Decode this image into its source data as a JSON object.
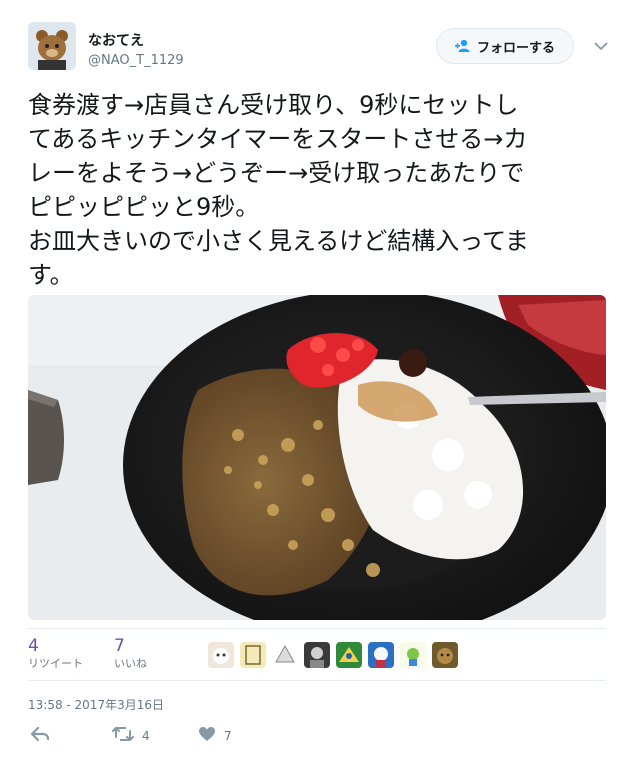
{
  "user": {
    "display_name": "なおてえ",
    "handle": "@NAO_T_1129"
  },
  "follow_button": {
    "label": "フォローする"
  },
  "tweet": {
    "text": "食券渡す→店員さん受け取り、9秒にセットし\nてあるキッチンタイマーをスタートさせる→カ\nレーをよそう→どうぞー→受け取ったあたりで\nピピッピピッと9秒。\nお皿大きいので小さく見えるけど結構入ってま\nす。"
  },
  "media": {
    "icon": "curry-photo"
  },
  "stats": {
    "retweets": {
      "count": "4",
      "label": "リツイート"
    },
    "likes": {
      "count": "7",
      "label": "いいね"
    }
  },
  "likers_count": 8,
  "timestamp": "13:58 - 2017年3月16日",
  "actions": {
    "reply": {
      "icon": "reply-icon"
    },
    "retweet": {
      "icon": "retweet-icon",
      "count": "4"
    },
    "like": {
      "icon": "heart-icon",
      "count": "7"
    }
  },
  "colors": {
    "count_purple": "#6e4fa8",
    "secondary_text": "#657786",
    "divider": "#e6ecf0"
  }
}
